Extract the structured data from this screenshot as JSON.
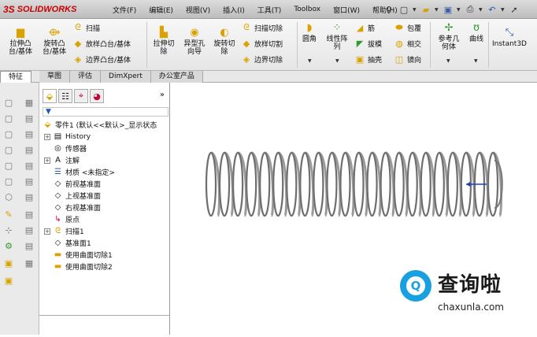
{
  "app": {
    "logo_text": "SOLIDWORKS",
    "logo_mark": "3S"
  },
  "menu": [
    "文件(F)",
    "编辑(E)",
    "视图(V)",
    "插入(I)",
    "工具(T)",
    "Toolbox",
    "窗口(W)",
    "帮助(H)"
  ],
  "ribbon": {
    "extrude_boss": "拉伸凸\n台/基体",
    "revolve_boss": "旋转凸\n台/基体",
    "sweep": "扫描",
    "loft_boss": "放样凸台/基体",
    "boundary_boss": "边界凸台/基体",
    "extrude_cut": "拉伸切\n除",
    "hole_wizard": "异型孔\n向导",
    "revolve_cut": "旋转切\n除",
    "swept_cut": "扫描切除",
    "lofted_cut": "放样切割",
    "boundary_cut": "边界切除",
    "fillet": "圆角",
    "linear_pattern": "线性阵\n列",
    "rib": "筋",
    "draft": "拔模",
    "shell": "抽壳",
    "wrap": "包覆",
    "intersect": "相交",
    "mirror": "镜向",
    "ref_geometry": "参考几\n何体",
    "curves": "曲线",
    "instant3d": "Instant3D"
  },
  "tabs": [
    "特征",
    "草图",
    "评估",
    "DimXpert",
    "办公室产品"
  ],
  "tree": {
    "root": "零件1 (默认<<默认>_显示状态",
    "items": [
      "History",
      "传感器",
      "注解",
      "材质 <未指定>",
      "前视基准面",
      "上视基准面",
      "右视基准面",
      "原点",
      "扫描1",
      "基准面1",
      "使用曲面切除1",
      "使用曲面切除2"
    ]
  },
  "watermark": {
    "title": "查询啦",
    "url": "chaxunla.com"
  },
  "colors": {
    "accent": "#19a0e0",
    "logo_red": "#cc0000"
  }
}
